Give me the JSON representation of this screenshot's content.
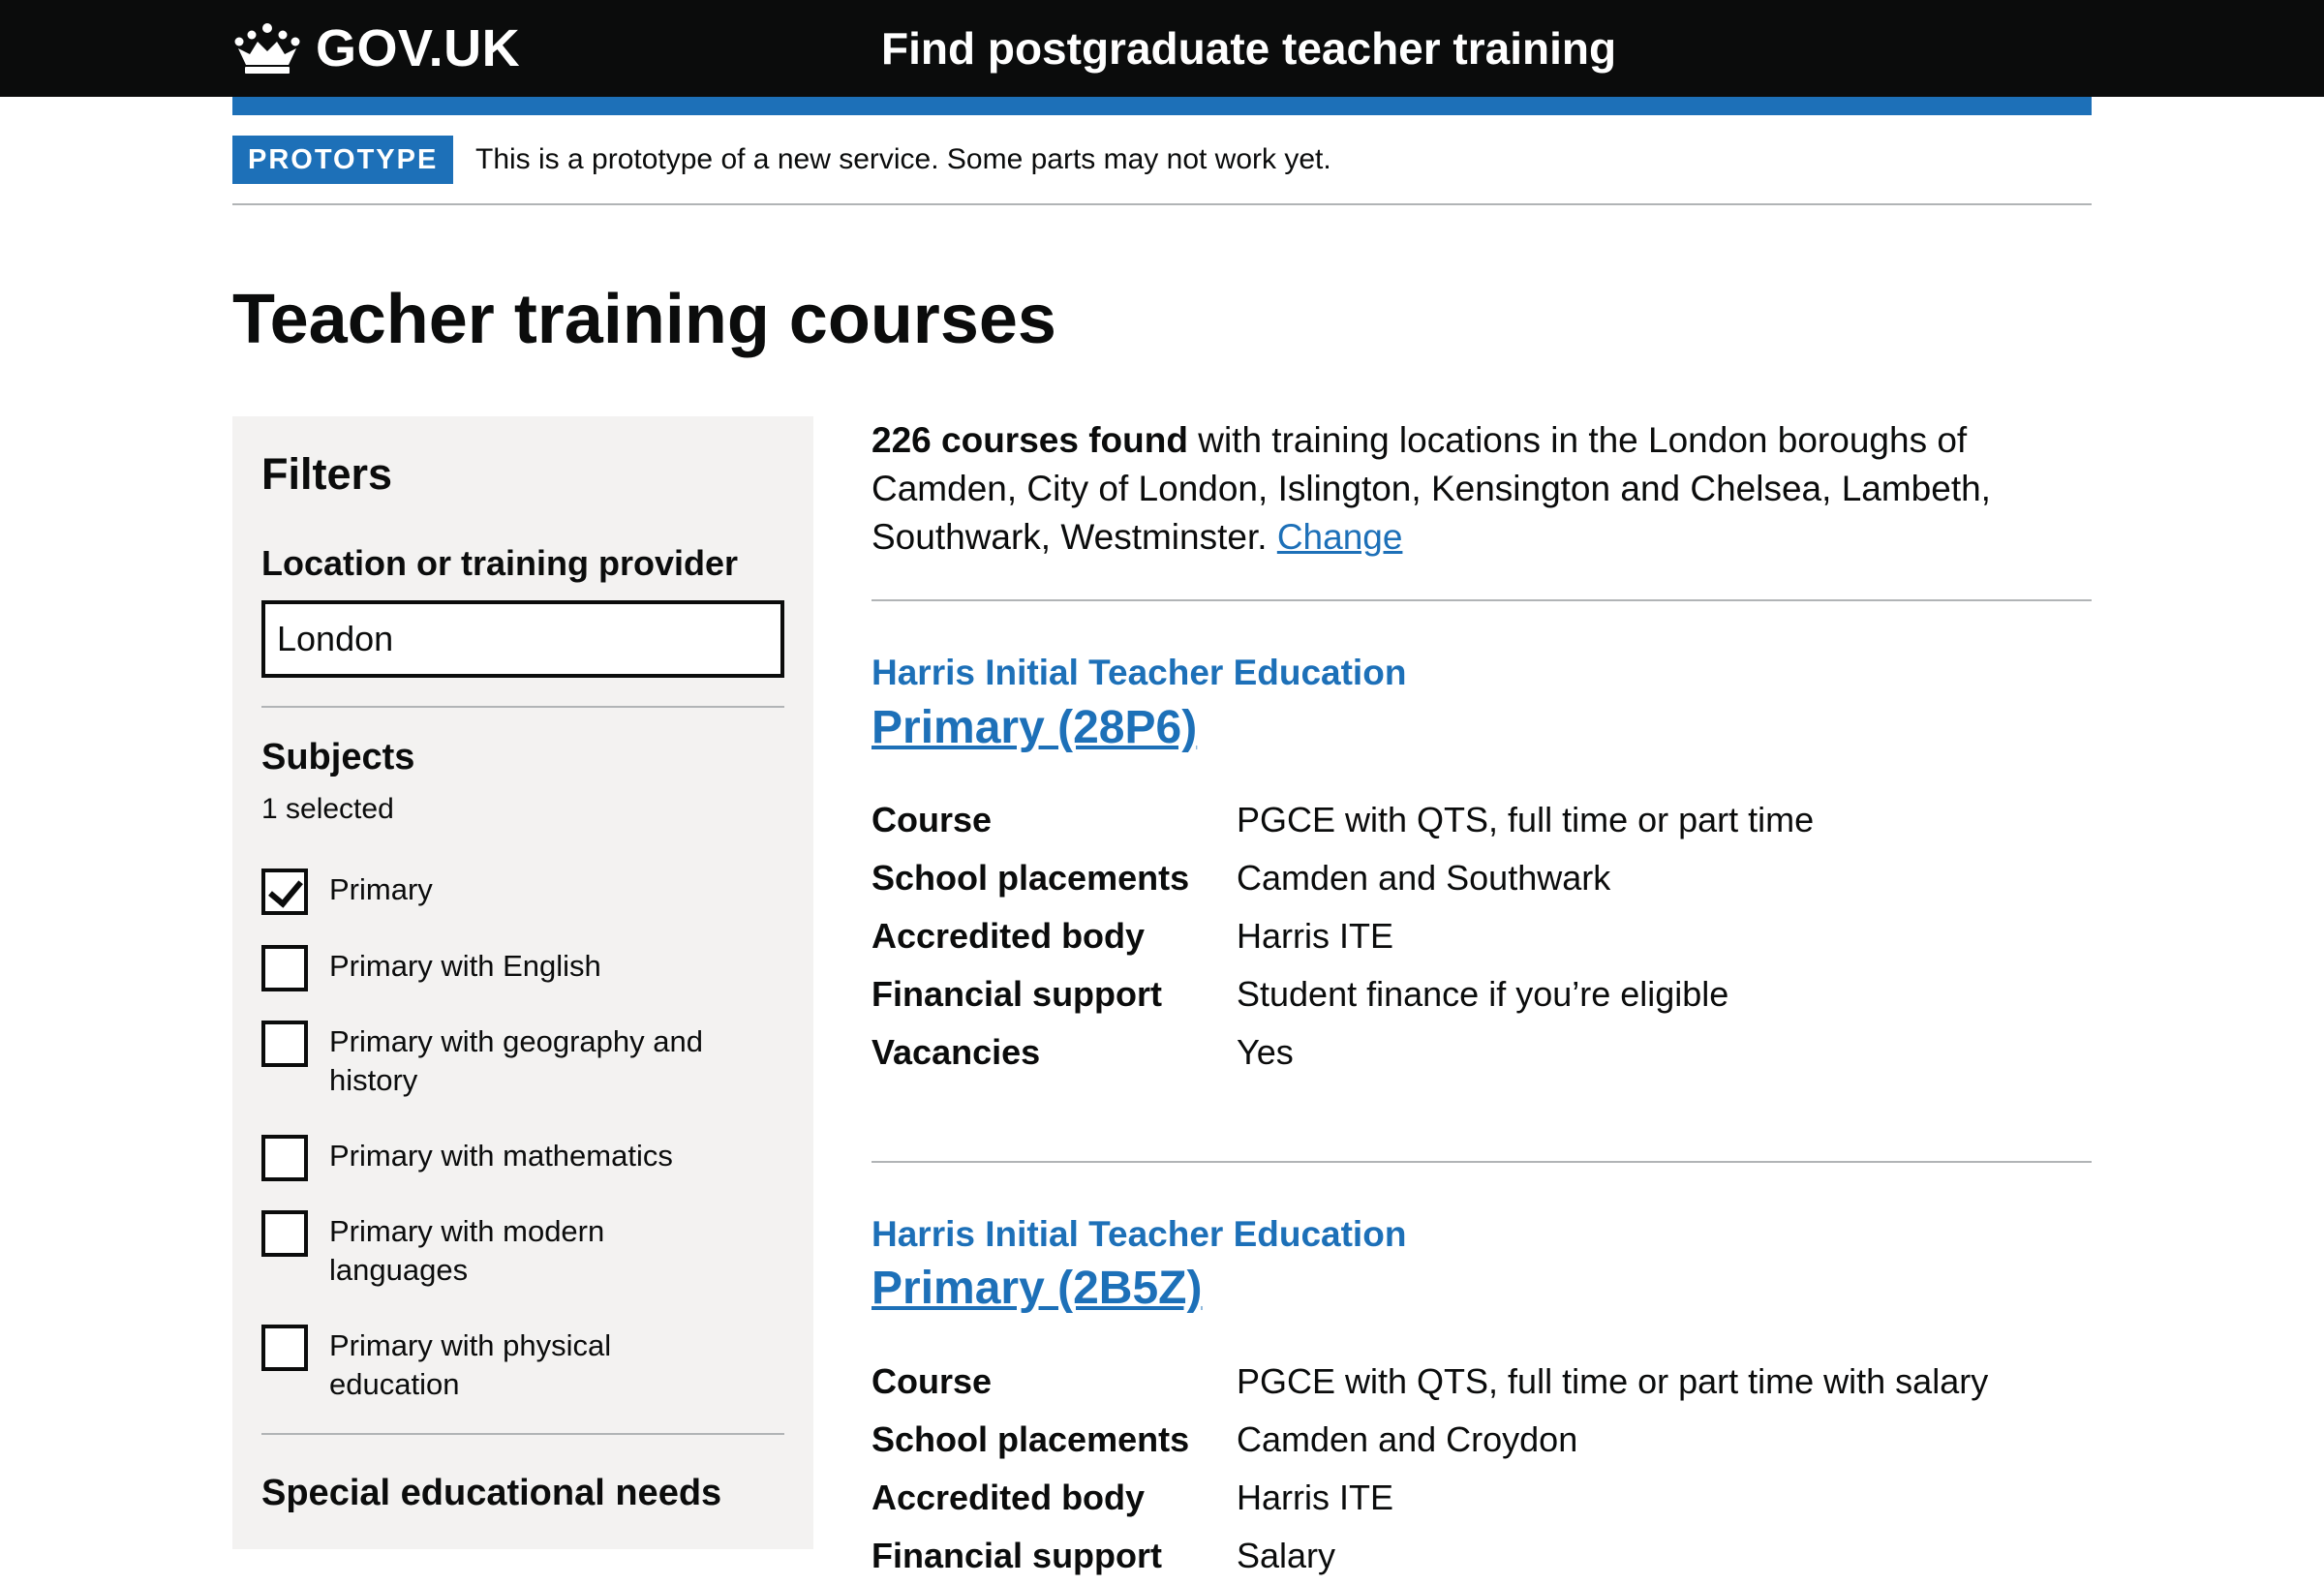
{
  "header": {
    "logo_text": "GOV.UK",
    "service_name": "Find postgraduate teacher training"
  },
  "phase_banner": {
    "tag": "PROTOTYPE",
    "text": "This is a prototype of a new service. Some parts may not work yet."
  },
  "page_title": "Teacher training courses",
  "filters": {
    "title": "Filters",
    "location_label": "Location or training provider",
    "location_value": "London",
    "subjects_title": "Subjects",
    "selected_count": "1 selected",
    "subjects": [
      {
        "label": "Primary",
        "checked": true
      },
      {
        "label": "Primary with English",
        "checked": false
      },
      {
        "label": "Primary with geography and history",
        "checked": false
      },
      {
        "label": "Primary with mathematics",
        "checked": false
      },
      {
        "label": "Primary with modern languages",
        "checked": false
      },
      {
        "label": "Primary with physical education",
        "checked": false
      }
    ],
    "sen_title": "Special educational needs"
  },
  "results": {
    "count_text": "226 courses found",
    "summary_text": " with training locations in the London boroughs of Camden, City of London, Islington, Kensington and Chelsea, Lambeth, Southwark, Westminster. ",
    "change_link": "Change",
    "courses": [
      {
        "provider": "Harris Initial Teacher Education",
        "title": "Primary (28P6)",
        "details": [
          {
            "term": "Course",
            "value": "PGCE with QTS, full time or part time"
          },
          {
            "term": "School placements",
            "value": "Camden and Southwark"
          },
          {
            "term": "Accredited body",
            "value": "Harris ITE"
          },
          {
            "term": "Financial support",
            "value": "Student finance if you’re eligible"
          },
          {
            "term": "Vacancies",
            "value": "Yes"
          }
        ]
      },
      {
        "provider": "Harris Initial Teacher Education",
        "title": "Primary (2B5Z)",
        "details": [
          {
            "term": "Course",
            "value": "PGCE with QTS, full time or part time with salary"
          },
          {
            "term": "School placements",
            "value": "Camden and Croydon"
          },
          {
            "term": "Accredited body",
            "value": "Harris ITE"
          },
          {
            "term": "Financial support",
            "value": "Salary"
          }
        ]
      }
    ]
  },
  "colors": {
    "header_bg": "#0b0c0c",
    "brand_blue": "#1d70b8",
    "sidebar_bg": "#f3f2f1",
    "divider": "#b1b4b6"
  }
}
